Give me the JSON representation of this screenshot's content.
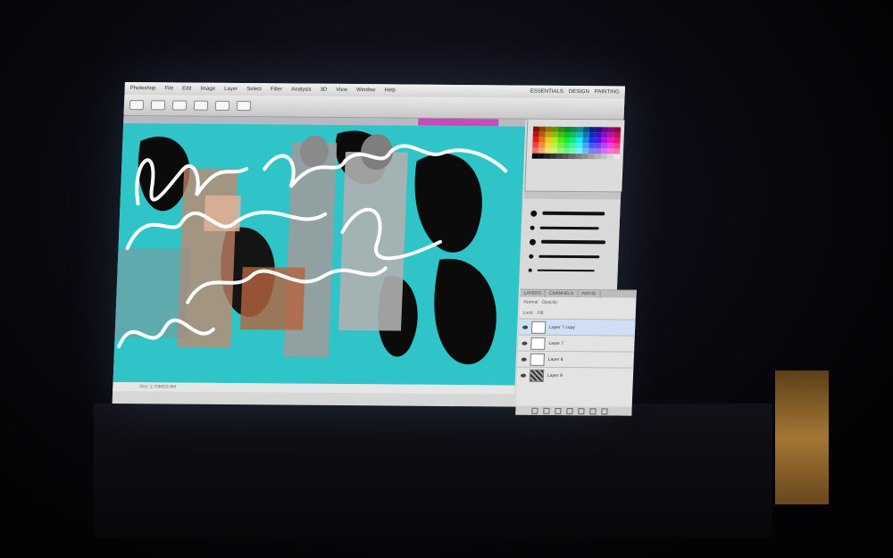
{
  "app": {
    "name": "Photoshop",
    "menu": [
      "File",
      "Edit",
      "Image",
      "Layer",
      "Select",
      "Filter",
      "Analysis",
      "3D",
      "View",
      "Window",
      "Help"
    ],
    "workspace": [
      "ESSENTIALS",
      "DESIGN",
      "PAINTING"
    ]
  },
  "status": {
    "doc": "Doc: 2.75M/22.8M"
  },
  "panels": {
    "layers_tabs": [
      "LAYERS",
      "CHANNELS",
      "PATHS"
    ],
    "blend_mode": "Normal",
    "opacity_label": "Opacity:",
    "lock_label": "Lock:",
    "fill_label": "Fill:",
    "layers": [
      {
        "name": "Layer 7 copy"
      },
      {
        "name": "Layer 7"
      },
      {
        "name": "Layer 8"
      },
      {
        "name": "Layer 9"
      }
    ]
  },
  "colors": {
    "canvas_bg": "#2ec4c8",
    "accent_magenta": "#c64ab8",
    "scribble": "#ffffff"
  }
}
